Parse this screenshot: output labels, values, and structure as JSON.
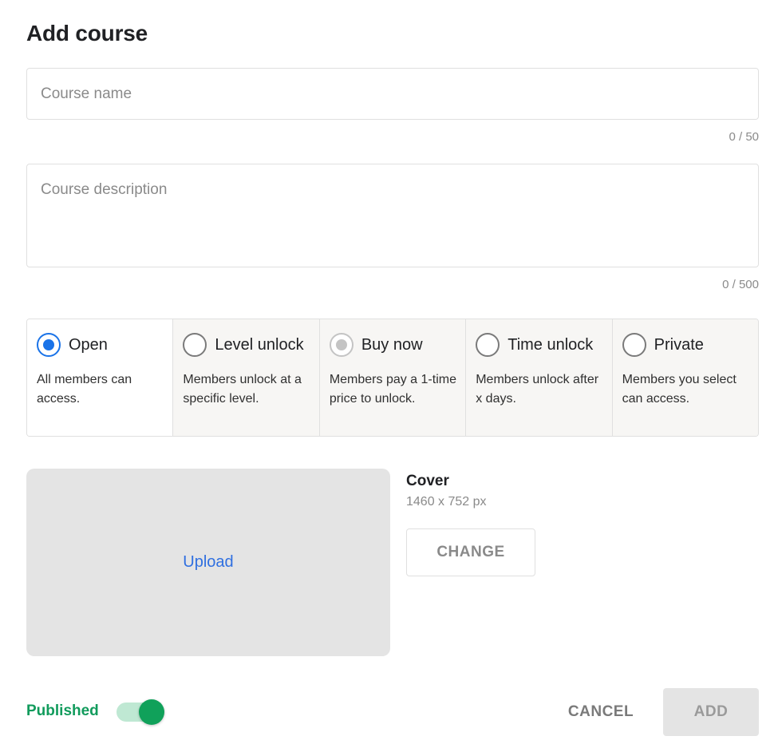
{
  "dialog": {
    "title": "Add course"
  },
  "name_field": {
    "placeholder": "Course name",
    "value": "",
    "counter": "0 / 50"
  },
  "description_field": {
    "placeholder": "Course description",
    "value": "",
    "counter": "0 / 500"
  },
  "access_options": [
    {
      "label": "Open",
      "description": "All members can access.",
      "state": "selected"
    },
    {
      "label": "Level unlock",
      "description": "Members unlock at a specific level.",
      "state": "unselected"
    },
    {
      "label": "Buy now",
      "description": "Members pay a 1-time price to unlock.",
      "state": "disabled"
    },
    {
      "label": "Time unlock",
      "description": "Members unlock after x days.",
      "state": "unselected"
    },
    {
      "label": "Private",
      "description": "Members you select can access.",
      "state": "unselected"
    }
  ],
  "cover": {
    "upload_label": "Upload",
    "title": "Cover",
    "size": "1460 x 752 px",
    "change_label": "CHANGE"
  },
  "footer": {
    "published_label": "Published",
    "published_on": true,
    "cancel_label": "CANCEL",
    "add_label": "ADD"
  },
  "colors": {
    "accent_blue": "#1a73e8",
    "published_green": "#119b5c",
    "toggle_track": "#bfe8d3"
  }
}
